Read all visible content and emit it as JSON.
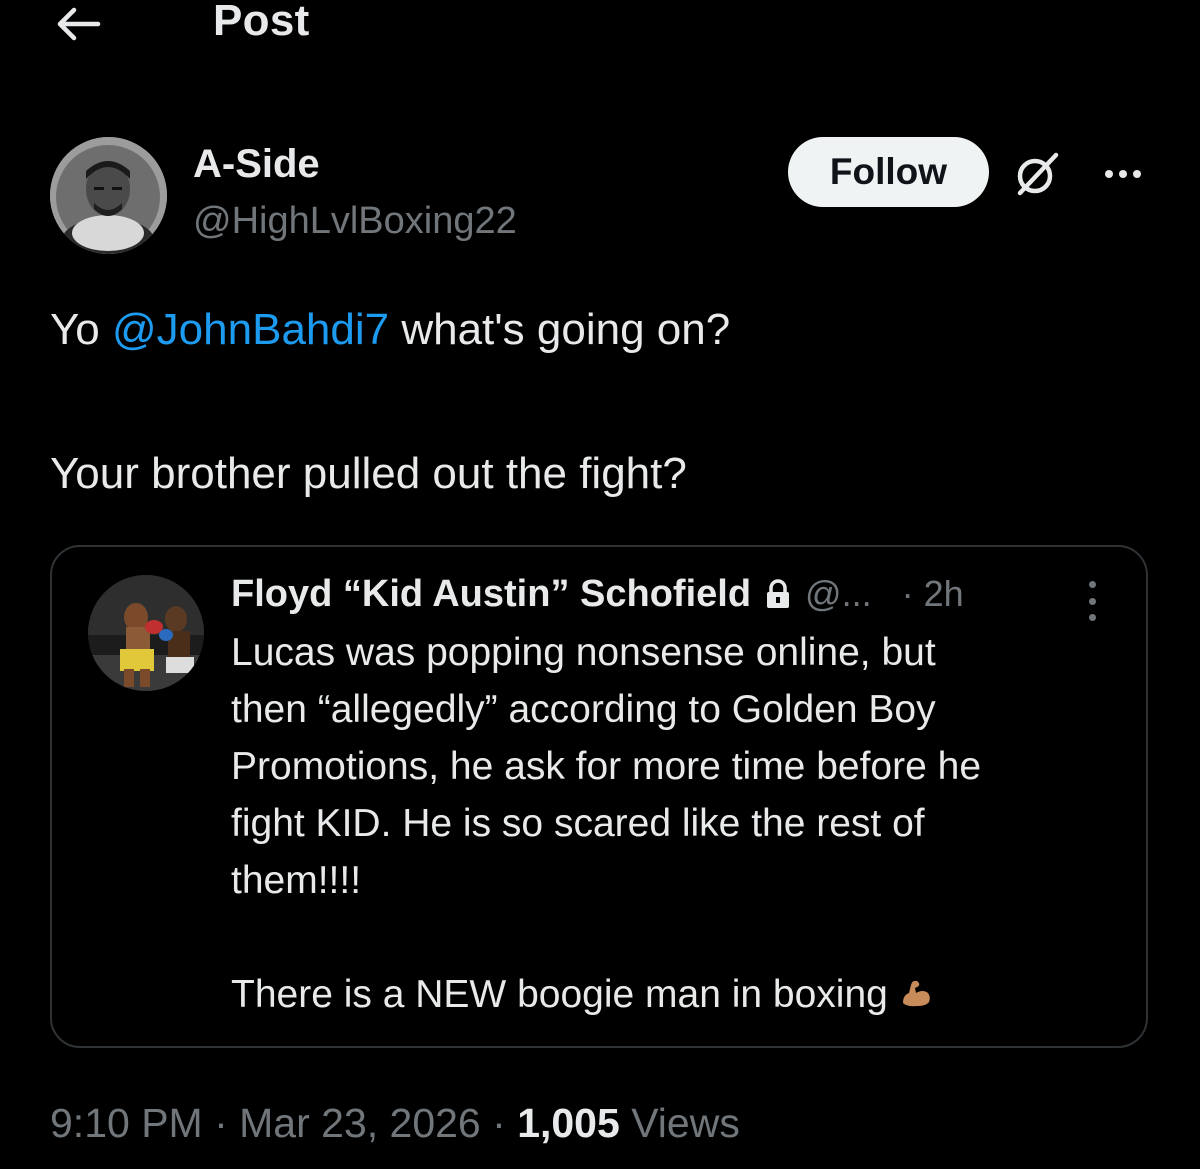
{
  "header": {
    "title": "Post"
  },
  "author": {
    "name": "A-Side",
    "handle": "@HighLvlBoxing22"
  },
  "follow_label": "Follow",
  "post": {
    "prefix": "Yo ",
    "mention": "@JohnBahdi7",
    "suffix": " what's going on?",
    "line2": "Your brother pulled out the fight?"
  },
  "quote": {
    "name": "Floyd “Kid Austin” Schofield",
    "handle": "@...",
    "time": "· 2h",
    "lines": [
      "Lucas was popping nonsense online, but",
      "then “allegedly” according to Golden Boy",
      "Promotions, he ask for more time before he",
      "fight KID. He is so scared like the rest of",
      "them!!!!",
      "There is a NEW boogie man in boxing"
    ]
  },
  "meta": {
    "time": "9:10 PM",
    "sep1": " · ",
    "date": "Mar 23, 2026",
    "sep2": " · ",
    "views_count": "1,005",
    "views_label": " Views"
  },
  "icons": {
    "back": "arrow-left-icon",
    "grok": "grok-icon",
    "more": "more-horizontal-icon",
    "lock": "lock-icon",
    "quote_more": "more-vertical-icon",
    "emoji": "flexed-biceps-icon"
  },
  "colors": {
    "background": "#000000",
    "text": "#e7e9ea",
    "secondary": "#71767b",
    "link": "#1d9bf0",
    "border": "#2f3336",
    "follow_bg": "#eff3f4"
  }
}
